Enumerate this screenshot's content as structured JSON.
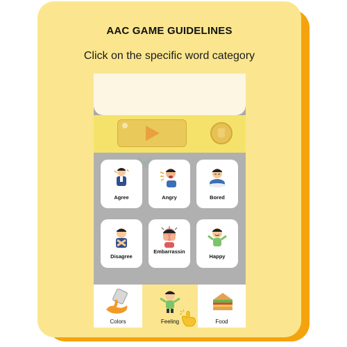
{
  "header": {
    "title": "AAC GAME GUIDELINES",
    "instruction": "Click on the specific word category"
  },
  "word_tiles": [
    {
      "label": "Agree",
      "icon": "person-agreeing-icon"
    },
    {
      "label": "Angry",
      "icon": "person-angry-icon"
    },
    {
      "label": "Bored",
      "icon": "person-bored-icon"
    },
    {
      "label": "Disagree",
      "icon": "person-disagreeing-icon"
    },
    {
      "label": "Embarrassin",
      "icon": "person-embarrassed-icon"
    },
    {
      "label": "Happy",
      "icon": "person-happy-icon"
    }
  ],
  "categories": [
    {
      "label": "Colors",
      "icon": "paint-bucket-icon",
      "selected": false
    },
    {
      "label": "Feeling",
      "icon": "happy-child-icon",
      "selected": true
    },
    {
      "label": "Food",
      "icon": "sandwich-icon",
      "selected": false
    }
  ],
  "colors": {
    "card": "#fbe68f",
    "card_shadow": "#f4a30f",
    "selected_tab": "#fbe68f",
    "control_bar": "#f5e26a"
  }
}
